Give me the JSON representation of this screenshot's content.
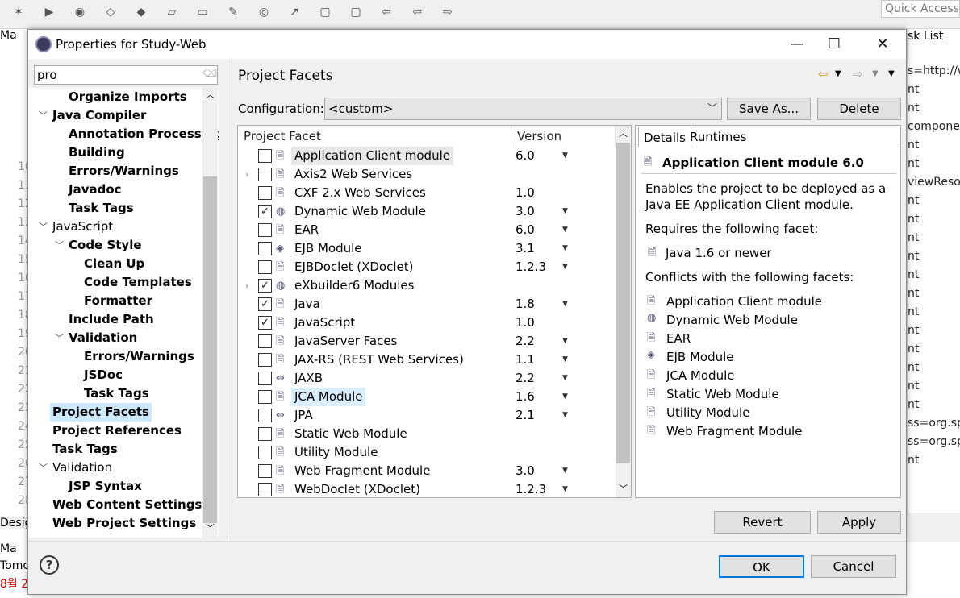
{
  "quick_access": "Quick Access",
  "background": {
    "left_tab": "Ma",
    "left_lines": [
      "10",
      "11",
      "12",
      "13",
      "14",
      "15",
      "16",
      "17",
      "18",
      "19",
      "20",
      "21",
      "22",
      "23",
      "24",
      "25",
      "26",
      "27",
      "28"
    ],
    "right_tab": "sk List",
    "right_lines": [
      "s=http://w",
      "nt",
      "nt",
      "componen",
      "nt",
      "nt",
      "viewReso",
      "nt",
      "nt",
      "nt",
      "nt",
      "nt",
      "nt",
      "nt",
      "nt",
      "nt",
      "nt",
      "nt",
      "nt",
      "ss=org.spr",
      "ss=org.spr",
      "nt"
    ],
    "bottom_tab1": "Desig",
    "bottom_tab2": "Ma",
    "bottom_line1": "Tomc",
    "bottom_line2": "8월 2"
  },
  "dialog": {
    "title": "Properties for Study-Web",
    "filter_value": "pro",
    "tree": [
      {
        "label": "Organize Imports",
        "indent": 2,
        "bold": true,
        "toggle": ""
      },
      {
        "label": "Java Compiler",
        "indent": 1,
        "bold": true,
        "toggle": "v"
      },
      {
        "label": "Annotation Processing",
        "indent": 2,
        "bold": true,
        "toggle": ""
      },
      {
        "label": "Building",
        "indent": 2,
        "bold": true,
        "toggle": ""
      },
      {
        "label": "Errors/Warnings",
        "indent": 2,
        "bold": true,
        "toggle": ""
      },
      {
        "label": "Javadoc",
        "indent": 2,
        "bold": true,
        "toggle": ""
      },
      {
        "label": "Task Tags",
        "indent": 2,
        "bold": true,
        "toggle": ""
      },
      {
        "label": "JavaScript",
        "indent": 1,
        "bold": false,
        "toggle": "v"
      },
      {
        "label": "Code Style",
        "indent": 2,
        "bold": true,
        "toggle": "v"
      },
      {
        "label": "Clean Up",
        "indent": 3,
        "bold": true,
        "toggle": ""
      },
      {
        "label": "Code Templates",
        "indent": 3,
        "bold": true,
        "toggle": ""
      },
      {
        "label": "Formatter",
        "indent": 3,
        "bold": true,
        "toggle": ""
      },
      {
        "label": "Include Path",
        "indent": 2,
        "bold": true,
        "toggle": ""
      },
      {
        "label": "Validation",
        "indent": 2,
        "bold": true,
        "toggle": "v"
      },
      {
        "label": "Errors/Warnings",
        "indent": 3,
        "bold": true,
        "toggle": ""
      },
      {
        "label": "JSDoc",
        "indent": 3,
        "bold": true,
        "toggle": ""
      },
      {
        "label": "Task Tags",
        "indent": 3,
        "bold": true,
        "toggle": ""
      },
      {
        "label": "Project Facets",
        "indent": 1,
        "bold": true,
        "toggle": "",
        "selected": true
      },
      {
        "label": "Project References",
        "indent": 1,
        "bold": true,
        "toggle": ""
      },
      {
        "label": "Task Tags",
        "indent": 1,
        "bold": true,
        "toggle": ""
      },
      {
        "label": "Validation",
        "indent": 1,
        "bold": false,
        "toggle": "v"
      },
      {
        "label": "JSP Syntax",
        "indent": 2,
        "bold": true,
        "toggle": ""
      },
      {
        "label": "Web Content Settings",
        "indent": 1,
        "bold": true,
        "toggle": ""
      },
      {
        "label": "Web Project Settings",
        "indent": 1,
        "bold": true,
        "toggle": ""
      }
    ],
    "page_title": "Project Facets",
    "config_label": "Configuration:",
    "config_value": "<custom>",
    "save_as_label": "Save As...",
    "delete_label": "Delete",
    "col_facet": "Project Facet",
    "col_version": "Version",
    "facets": [
      {
        "name": "Application Client module",
        "version": "6.0",
        "checked": false,
        "dd": true,
        "icon": "doc",
        "hl": "gray"
      },
      {
        "name": "Axis2 Web Services",
        "version": "",
        "checked": false,
        "dd": false,
        "icon": "doc",
        "expand": true
      },
      {
        "name": "CXF 2.x Web Services",
        "version": "1.0",
        "checked": false,
        "dd": false,
        "icon": "doc"
      },
      {
        "name": "Dynamic Web Module",
        "version": "3.0",
        "checked": true,
        "dd": true,
        "icon": "globe"
      },
      {
        "name": "EAR",
        "version": "6.0",
        "checked": false,
        "dd": true,
        "icon": "doc"
      },
      {
        "name": "EJB Module",
        "version": "3.1",
        "checked": false,
        "dd": true,
        "icon": "bean"
      },
      {
        "name": "EJBDoclet (XDoclet)",
        "version": "1.2.3",
        "checked": false,
        "dd": true,
        "icon": "doc"
      },
      {
        "name": "eXbuilder6 Modules",
        "version": "",
        "checked": true,
        "dd": false,
        "icon": "globe",
        "expand": true
      },
      {
        "name": "Java",
        "version": "1.8",
        "checked": true,
        "dd": true,
        "icon": "java"
      },
      {
        "name": "JavaScript",
        "version": "1.0",
        "checked": true,
        "dd": false,
        "icon": "doc"
      },
      {
        "name": "JavaServer Faces",
        "version": "2.2",
        "checked": false,
        "dd": true,
        "icon": "doc"
      },
      {
        "name": "JAX-RS (REST Web Services)",
        "version": "1.1",
        "checked": false,
        "dd": true,
        "icon": "doc"
      },
      {
        "name": "JAXB",
        "version": "2.2",
        "checked": false,
        "dd": true,
        "icon": "arrows"
      },
      {
        "name": "JCA Module",
        "version": "1.6",
        "checked": false,
        "dd": true,
        "icon": "doc",
        "hl": "blue"
      },
      {
        "name": "JPA",
        "version": "2.1",
        "checked": false,
        "dd": true,
        "icon": "arrows"
      },
      {
        "name": "Static Web Module",
        "version": "",
        "checked": false,
        "dd": false,
        "icon": "doc"
      },
      {
        "name": "Utility Module",
        "version": "",
        "checked": false,
        "dd": false,
        "icon": "doc"
      },
      {
        "name": "Web Fragment Module",
        "version": "3.0",
        "checked": false,
        "dd": true,
        "icon": "doc"
      },
      {
        "name": "WebDoclet (XDoclet)",
        "version": "1.2.3",
        "checked": false,
        "dd": true,
        "icon": "doc"
      }
    ],
    "tab_details": "Details",
    "tab_runtimes": "Runtimes",
    "details_title": "Application Client module 6.0",
    "details_desc1": "Enables the project to be deployed as a",
    "details_desc2": "Java EE Application Client module.",
    "requires_label": "Requires the following facet:",
    "requires_item": "Java 1.6 or newer",
    "conflicts_label": "Conflicts with the following facets:",
    "conflicts": [
      {
        "name": "Application Client module",
        "icon": "doc"
      },
      {
        "name": "Dynamic Web Module",
        "icon": "globe"
      },
      {
        "name": "EAR",
        "icon": "doc"
      },
      {
        "name": "EJB Module",
        "icon": "bean"
      },
      {
        "name": "JCA Module",
        "icon": "doc"
      },
      {
        "name": "Static Web Module",
        "icon": "doc"
      },
      {
        "name": "Utility Module",
        "icon": "doc"
      },
      {
        "name": "Web Fragment Module",
        "icon": "doc"
      }
    ],
    "revert_label": "Revert",
    "apply_label": "Apply",
    "ok_label": "OK",
    "cancel_label": "Cancel",
    "help_glyph": "?"
  }
}
